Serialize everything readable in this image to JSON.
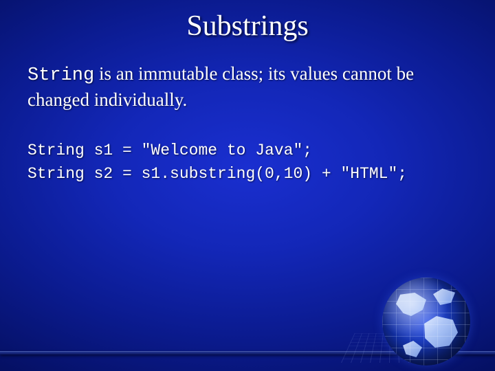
{
  "title": "Substrings",
  "body": {
    "code_word": "String",
    "rest": " is an immutable class; its values cannot be changed individually."
  },
  "code": {
    "line1": "String s1 = \"Welcome to Java\";",
    "line2": "String s2 = s1.substring(0,10) + \"HTML\";"
  }
}
